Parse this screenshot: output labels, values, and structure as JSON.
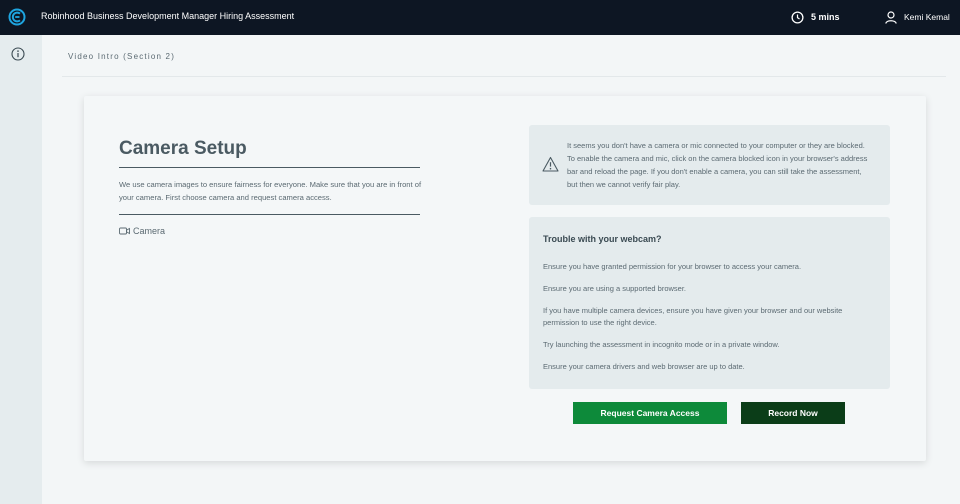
{
  "app": {
    "title": "Robinhood Business Development Manager Hiring Assessment",
    "logo_icon": "logo-icon",
    "accent": "#1ea5e0"
  },
  "header": {
    "timer_icon": "clock-icon",
    "timer": "5 mins",
    "user_icon": "user-icon",
    "user_name": "Kemi Kemal"
  },
  "sidebar": {
    "info_icon": "info-icon"
  },
  "section": {
    "title": "Video Intro (Section 2)"
  },
  "camera_setup": {
    "title": "Camera Setup",
    "description": "We use camera images to ensure fairness for everyone. Make sure that you are in front of your camera. First choose camera and request camera access.",
    "camera_icon": "video-camera-icon",
    "camera_label": "Camera"
  },
  "warning": {
    "icon": "warning-icon",
    "text": "It seems you don't have a camera or mic connected to your computer or they are blocked. To enable the camera and mic, click on the camera blocked icon in your browser's address bar and reload the page. If you don't enable a camera, you can still take the assessment, but then we cannot verify fair play."
  },
  "trouble": {
    "title": "Trouble with your webcam?",
    "items": [
      "Ensure you have granted permission for your browser to access your camera.",
      "Ensure you are using a supported browser.",
      "If you have multiple camera devices, ensure you have given your browser and our website permission to use the right device.",
      "Try launching the assessment in incognito mode or in a private window.",
      "Ensure your camera drivers and web browser are up to date."
    ]
  },
  "buttons": {
    "request_camera": "Request Camera Access",
    "record_now": "Record Now",
    "request_color": "#0d8a3a",
    "record_color": "#0b3d18"
  }
}
